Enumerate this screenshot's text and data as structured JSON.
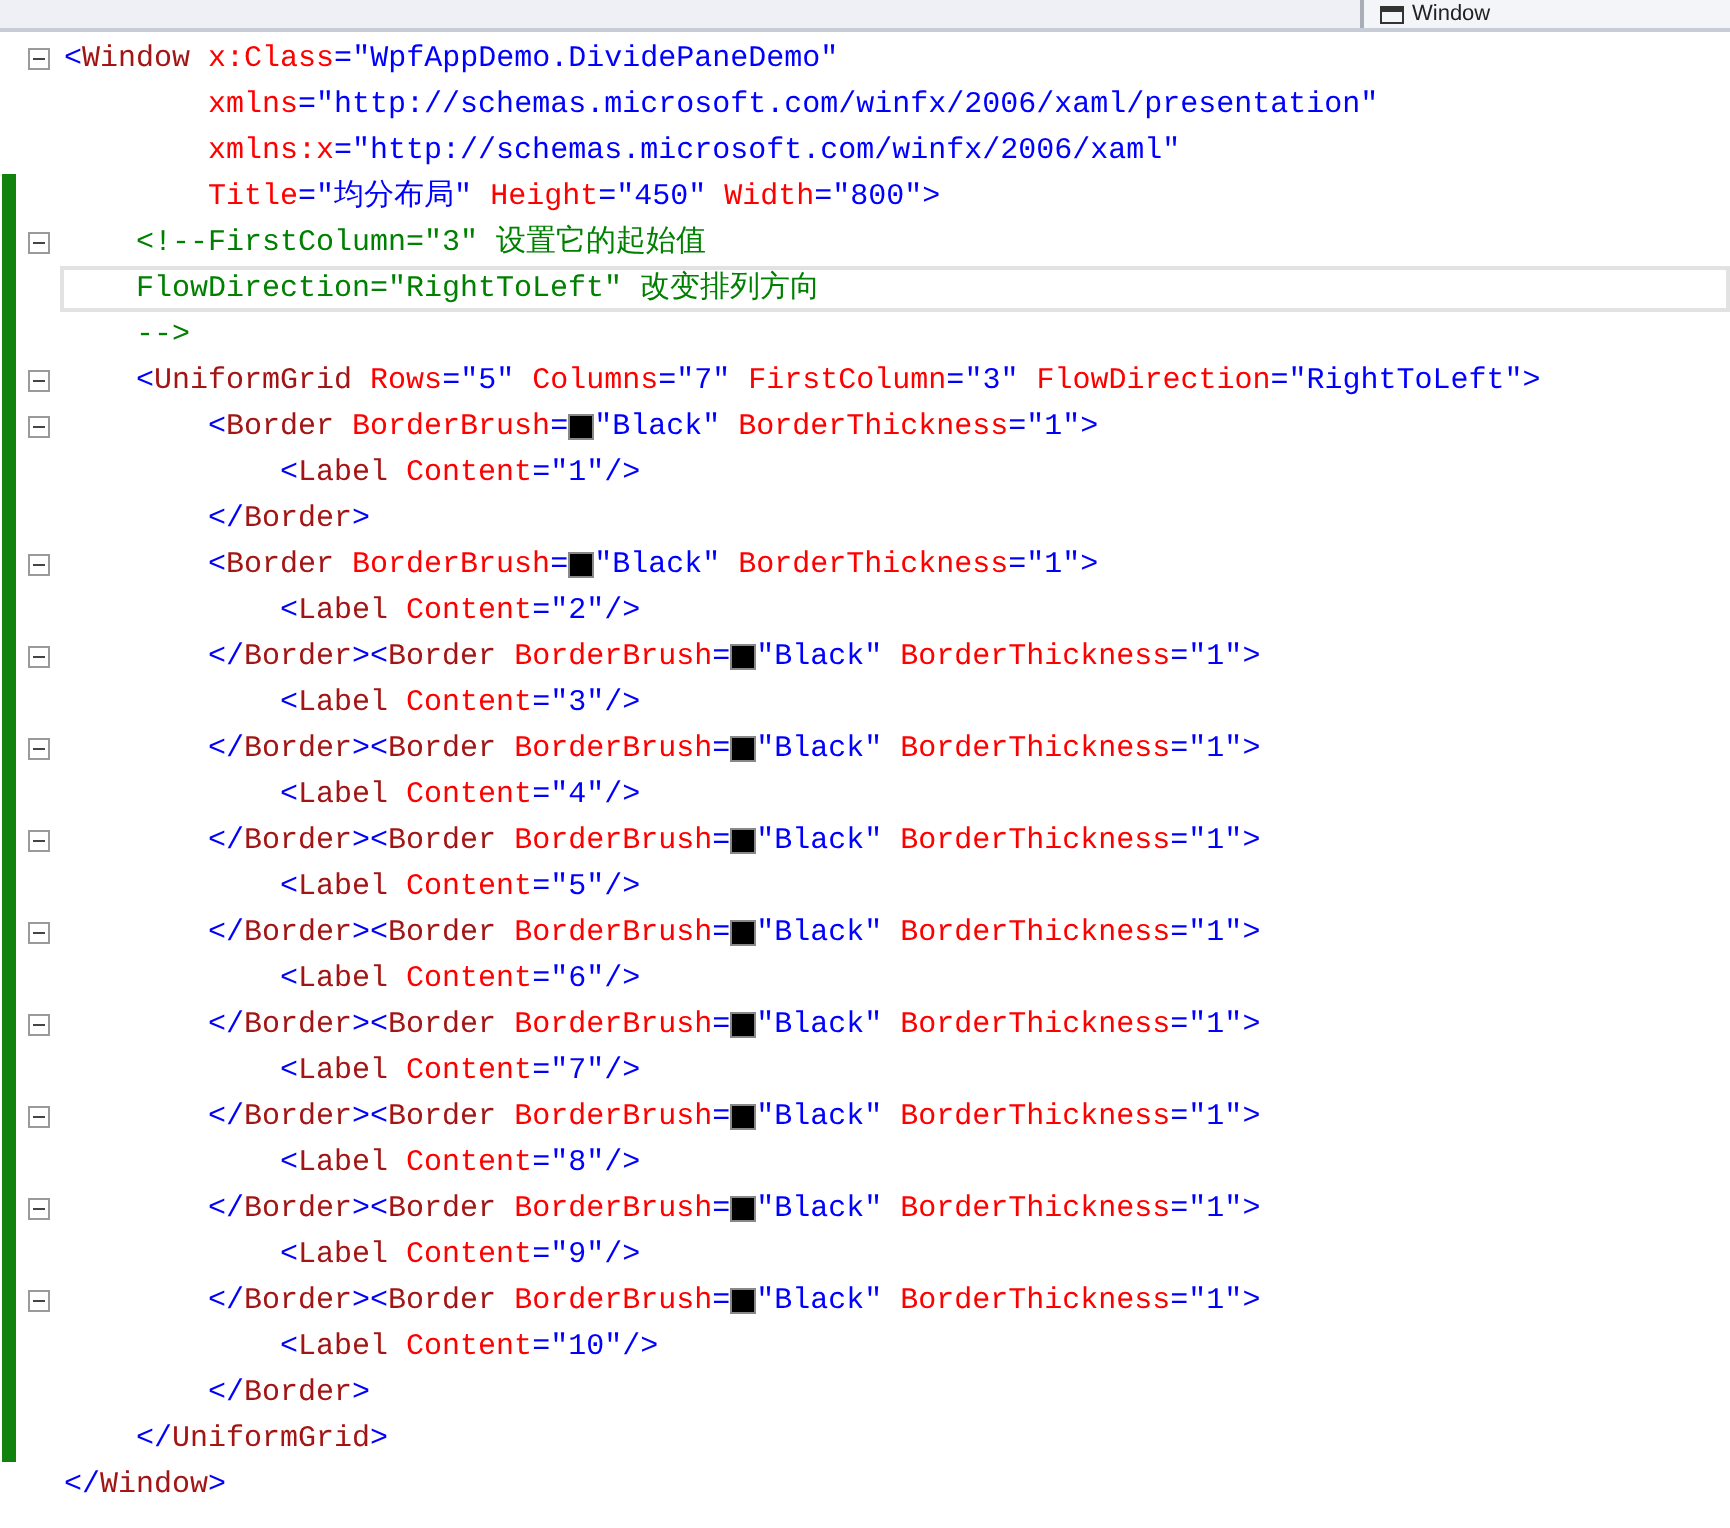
{
  "top_bar": {
    "dropdown": {
      "label": "Window"
    }
  },
  "lines": [
    {
      "fold": true,
      "changed": false,
      "current": false,
      "tokens": [
        {
          "kind": "punct",
          "text": "<"
        },
        {
          "kind": "element",
          "text": "Window"
        },
        {
          "kind": "attribute",
          "text": " x:Class"
        },
        {
          "kind": "punct",
          "text": "="
        },
        {
          "kind": "value",
          "text": "\"WpfAppDemo.DividePaneDemo\""
        }
      ]
    },
    {
      "fold": false,
      "changed": false,
      "current": false,
      "tokens": [
        {
          "kind": "attribute",
          "text": "        xmlns"
        },
        {
          "kind": "punct",
          "text": "="
        },
        {
          "kind": "value",
          "text": "\"http://schemas.microsoft.com/winfx/2006/xaml/presentation\""
        }
      ]
    },
    {
      "fold": false,
      "changed": false,
      "current": false,
      "tokens": [
        {
          "kind": "attribute",
          "text": "        xmlns:x"
        },
        {
          "kind": "punct",
          "text": "="
        },
        {
          "kind": "value",
          "text": "\"http://schemas.microsoft.com/winfx/2006/xaml\""
        }
      ]
    },
    {
      "fold": false,
      "changed": true,
      "current": false,
      "tokens": [
        {
          "kind": "attribute",
          "text": "        Title"
        },
        {
          "kind": "punct",
          "text": "="
        },
        {
          "kind": "value",
          "text": "\"均分布局\""
        },
        {
          "kind": "attribute",
          "text": " Height"
        },
        {
          "kind": "punct",
          "text": "="
        },
        {
          "kind": "value",
          "text": "\"450\""
        },
        {
          "kind": "attribute",
          "text": " Width"
        },
        {
          "kind": "punct",
          "text": "="
        },
        {
          "kind": "value",
          "text": "\"800\""
        },
        {
          "kind": "punct",
          "text": ">"
        }
      ]
    },
    {
      "fold": true,
      "changed": true,
      "current": false,
      "tokens": [
        {
          "kind": "comment",
          "text": "    <!--FirstColumn=\"3\" 设置它的起始值"
        }
      ]
    },
    {
      "fold": false,
      "changed": true,
      "current": true,
      "tokens": [
        {
          "kind": "comment",
          "text": "    FlowDirection=\"RightToLeft\" 改变排列方向"
        }
      ]
    },
    {
      "fold": false,
      "changed": true,
      "current": false,
      "tokens": [
        {
          "kind": "comment",
          "text": "    -->"
        }
      ]
    },
    {
      "fold": true,
      "changed": true,
      "current": false,
      "tokens": [
        {
          "kind": "punct",
          "text": "    <"
        },
        {
          "kind": "element",
          "text": "UniformGrid"
        },
        {
          "kind": "attribute",
          "text": " Rows"
        },
        {
          "kind": "punct",
          "text": "="
        },
        {
          "kind": "value",
          "text": "\"5\""
        },
        {
          "kind": "attribute",
          "text": " Columns"
        },
        {
          "kind": "punct",
          "text": "="
        },
        {
          "kind": "value",
          "text": "\"7\""
        },
        {
          "kind": "attribute",
          "text": " FirstColumn"
        },
        {
          "kind": "punct",
          "text": "="
        },
        {
          "kind": "value",
          "text": "\"3\""
        },
        {
          "kind": "attribute",
          "text": " FlowDirection"
        },
        {
          "kind": "punct",
          "text": "="
        },
        {
          "kind": "value",
          "text": "\"RightToLeft\""
        },
        {
          "kind": "punct",
          "text": ">"
        }
      ]
    },
    {
      "fold": true,
      "changed": true,
      "current": false,
      "tokens": [
        {
          "kind": "punct",
          "text": "        <"
        },
        {
          "kind": "element",
          "text": "Border"
        },
        {
          "kind": "attribute",
          "text": " BorderBrush"
        },
        {
          "kind": "punct",
          "text": "="
        },
        {
          "kind": "swatch",
          "color": "#000000"
        },
        {
          "kind": "value",
          "text": "\"Black\""
        },
        {
          "kind": "attribute",
          "text": " BorderThickness"
        },
        {
          "kind": "punct",
          "text": "="
        },
        {
          "kind": "value",
          "text": "\"1\""
        },
        {
          "kind": "punct",
          "text": ">"
        }
      ]
    },
    {
      "fold": false,
      "changed": true,
      "current": false,
      "tokens": [
        {
          "kind": "punct",
          "text": "            <"
        },
        {
          "kind": "element",
          "text": "Label"
        },
        {
          "kind": "attribute",
          "text": " Content"
        },
        {
          "kind": "punct",
          "text": "="
        },
        {
          "kind": "value",
          "text": "\"1\""
        },
        {
          "kind": "punct",
          "text": "/>"
        }
      ]
    },
    {
      "fold": false,
      "changed": true,
      "current": false,
      "tokens": [
        {
          "kind": "punct",
          "text": "        </"
        },
        {
          "kind": "element",
          "text": "Border"
        },
        {
          "kind": "punct",
          "text": ">"
        }
      ]
    },
    {
      "fold": true,
      "changed": true,
      "current": false,
      "tokens": [
        {
          "kind": "punct",
          "text": "        <"
        },
        {
          "kind": "element",
          "text": "Border"
        },
        {
          "kind": "attribute",
          "text": " BorderBrush"
        },
        {
          "kind": "punct",
          "text": "="
        },
        {
          "kind": "swatch",
          "color": "#000000"
        },
        {
          "kind": "value",
          "text": "\"Black\""
        },
        {
          "kind": "attribute",
          "text": " BorderThickness"
        },
        {
          "kind": "punct",
          "text": "="
        },
        {
          "kind": "value",
          "text": "\"1\""
        },
        {
          "kind": "punct",
          "text": ">"
        }
      ]
    },
    {
      "fold": false,
      "changed": true,
      "current": false,
      "tokens": [
        {
          "kind": "punct",
          "text": "            <"
        },
        {
          "kind": "element",
          "text": "Label"
        },
        {
          "kind": "attribute",
          "text": " Content"
        },
        {
          "kind": "punct",
          "text": "="
        },
        {
          "kind": "value",
          "text": "\"2\""
        },
        {
          "kind": "punct",
          "text": "/>"
        }
      ]
    },
    {
      "fold": true,
      "changed": true,
      "current": false,
      "tokens": [
        {
          "kind": "punct",
          "text": "        </"
        },
        {
          "kind": "element",
          "text": "Border"
        },
        {
          "kind": "punct",
          "text": "><"
        },
        {
          "kind": "element",
          "text": "Border"
        },
        {
          "kind": "attribute",
          "text": " BorderBrush"
        },
        {
          "kind": "punct",
          "text": "="
        },
        {
          "kind": "swatch",
          "color": "#000000"
        },
        {
          "kind": "value",
          "text": "\"Black\""
        },
        {
          "kind": "attribute",
          "text": " BorderThickness"
        },
        {
          "kind": "punct",
          "text": "="
        },
        {
          "kind": "value",
          "text": "\"1\""
        },
        {
          "kind": "punct",
          "text": ">"
        }
      ]
    },
    {
      "fold": false,
      "changed": true,
      "current": false,
      "tokens": [
        {
          "kind": "punct",
          "text": "            <"
        },
        {
          "kind": "element",
          "text": "Label"
        },
        {
          "kind": "attribute",
          "text": " Content"
        },
        {
          "kind": "punct",
          "text": "="
        },
        {
          "kind": "value",
          "text": "\"3\""
        },
        {
          "kind": "punct",
          "text": "/>"
        }
      ]
    },
    {
      "fold": true,
      "changed": true,
      "current": false,
      "tokens": [
        {
          "kind": "punct",
          "text": "        </"
        },
        {
          "kind": "element",
          "text": "Border"
        },
        {
          "kind": "punct",
          "text": "><"
        },
        {
          "kind": "element",
          "text": "Border"
        },
        {
          "kind": "attribute",
          "text": " BorderBrush"
        },
        {
          "kind": "punct",
          "text": "="
        },
        {
          "kind": "swatch",
          "color": "#000000"
        },
        {
          "kind": "value",
          "text": "\"Black\""
        },
        {
          "kind": "attribute",
          "text": " BorderThickness"
        },
        {
          "kind": "punct",
          "text": "="
        },
        {
          "kind": "value",
          "text": "\"1\""
        },
        {
          "kind": "punct",
          "text": ">"
        }
      ]
    },
    {
      "fold": false,
      "changed": true,
      "current": false,
      "tokens": [
        {
          "kind": "punct",
          "text": "            <"
        },
        {
          "kind": "element",
          "text": "Label"
        },
        {
          "kind": "attribute",
          "text": " Content"
        },
        {
          "kind": "punct",
          "text": "="
        },
        {
          "kind": "value",
          "text": "\"4\""
        },
        {
          "kind": "punct",
          "text": "/>"
        }
      ]
    },
    {
      "fold": true,
      "changed": true,
      "current": false,
      "tokens": [
        {
          "kind": "punct",
          "text": "        </"
        },
        {
          "kind": "element",
          "text": "Border"
        },
        {
          "kind": "punct",
          "text": "><"
        },
        {
          "kind": "element",
          "text": "Border"
        },
        {
          "kind": "attribute",
          "text": " BorderBrush"
        },
        {
          "kind": "punct",
          "text": "="
        },
        {
          "kind": "swatch",
          "color": "#000000"
        },
        {
          "kind": "value",
          "text": "\"Black\""
        },
        {
          "kind": "attribute",
          "text": " BorderThickness"
        },
        {
          "kind": "punct",
          "text": "="
        },
        {
          "kind": "value",
          "text": "\"1\""
        },
        {
          "kind": "punct",
          "text": ">"
        }
      ]
    },
    {
      "fold": false,
      "changed": true,
      "current": false,
      "tokens": [
        {
          "kind": "punct",
          "text": "            <"
        },
        {
          "kind": "element",
          "text": "Label"
        },
        {
          "kind": "attribute",
          "text": " Content"
        },
        {
          "kind": "punct",
          "text": "="
        },
        {
          "kind": "value",
          "text": "\"5\""
        },
        {
          "kind": "punct",
          "text": "/>"
        }
      ]
    },
    {
      "fold": true,
      "changed": true,
      "current": false,
      "tokens": [
        {
          "kind": "punct",
          "text": "        </"
        },
        {
          "kind": "element",
          "text": "Border"
        },
        {
          "kind": "punct",
          "text": "><"
        },
        {
          "kind": "element",
          "text": "Border"
        },
        {
          "kind": "attribute",
          "text": " BorderBrush"
        },
        {
          "kind": "punct",
          "text": "="
        },
        {
          "kind": "swatch",
          "color": "#000000"
        },
        {
          "kind": "value",
          "text": "\"Black\""
        },
        {
          "kind": "attribute",
          "text": " BorderThickness"
        },
        {
          "kind": "punct",
          "text": "="
        },
        {
          "kind": "value",
          "text": "\"1\""
        },
        {
          "kind": "punct",
          "text": ">"
        }
      ]
    },
    {
      "fold": false,
      "changed": true,
      "current": false,
      "tokens": [
        {
          "kind": "punct",
          "text": "            <"
        },
        {
          "kind": "element",
          "text": "Label"
        },
        {
          "kind": "attribute",
          "text": " Content"
        },
        {
          "kind": "punct",
          "text": "="
        },
        {
          "kind": "value",
          "text": "\"6\""
        },
        {
          "kind": "punct",
          "text": "/>"
        }
      ]
    },
    {
      "fold": true,
      "changed": true,
      "current": false,
      "tokens": [
        {
          "kind": "punct",
          "text": "        </"
        },
        {
          "kind": "element",
          "text": "Border"
        },
        {
          "kind": "punct",
          "text": "><"
        },
        {
          "kind": "element",
          "text": "Border"
        },
        {
          "kind": "attribute",
          "text": " BorderBrush"
        },
        {
          "kind": "punct",
          "text": "="
        },
        {
          "kind": "swatch",
          "color": "#000000"
        },
        {
          "kind": "value",
          "text": "\"Black\""
        },
        {
          "kind": "attribute",
          "text": " BorderThickness"
        },
        {
          "kind": "punct",
          "text": "="
        },
        {
          "kind": "value",
          "text": "\"1\""
        },
        {
          "kind": "punct",
          "text": ">"
        }
      ]
    },
    {
      "fold": false,
      "changed": true,
      "current": false,
      "tokens": [
        {
          "kind": "punct",
          "text": "            <"
        },
        {
          "kind": "element",
          "text": "Label"
        },
        {
          "kind": "attribute",
          "text": " Content"
        },
        {
          "kind": "punct",
          "text": "="
        },
        {
          "kind": "value",
          "text": "\"7\""
        },
        {
          "kind": "punct",
          "text": "/>"
        }
      ]
    },
    {
      "fold": true,
      "changed": true,
      "current": false,
      "tokens": [
        {
          "kind": "punct",
          "text": "        </"
        },
        {
          "kind": "element",
          "text": "Border"
        },
        {
          "kind": "punct",
          "text": "><"
        },
        {
          "kind": "element",
          "text": "Border"
        },
        {
          "kind": "attribute",
          "text": " BorderBrush"
        },
        {
          "kind": "punct",
          "text": "="
        },
        {
          "kind": "swatch",
          "color": "#000000"
        },
        {
          "kind": "value",
          "text": "\"Black\""
        },
        {
          "kind": "attribute",
          "text": " BorderThickness"
        },
        {
          "kind": "punct",
          "text": "="
        },
        {
          "kind": "value",
          "text": "\"1\""
        },
        {
          "kind": "punct",
          "text": ">"
        }
      ]
    },
    {
      "fold": false,
      "changed": true,
      "current": false,
      "tokens": [
        {
          "kind": "punct",
          "text": "            <"
        },
        {
          "kind": "element",
          "text": "Label"
        },
        {
          "kind": "attribute",
          "text": " Content"
        },
        {
          "kind": "punct",
          "text": "="
        },
        {
          "kind": "value",
          "text": "\"8\""
        },
        {
          "kind": "punct",
          "text": "/>"
        }
      ]
    },
    {
      "fold": true,
      "changed": true,
      "current": false,
      "tokens": [
        {
          "kind": "punct",
          "text": "        </"
        },
        {
          "kind": "element",
          "text": "Border"
        },
        {
          "kind": "punct",
          "text": "><"
        },
        {
          "kind": "element",
          "text": "Border"
        },
        {
          "kind": "attribute",
          "text": " BorderBrush"
        },
        {
          "kind": "punct",
          "text": "="
        },
        {
          "kind": "swatch",
          "color": "#000000"
        },
        {
          "kind": "value",
          "text": "\"Black\""
        },
        {
          "kind": "attribute",
          "text": " BorderThickness"
        },
        {
          "kind": "punct",
          "text": "="
        },
        {
          "kind": "value",
          "text": "\"1\""
        },
        {
          "kind": "punct",
          "text": ">"
        }
      ]
    },
    {
      "fold": false,
      "changed": true,
      "current": false,
      "tokens": [
        {
          "kind": "punct",
          "text": "            <"
        },
        {
          "kind": "element",
          "text": "Label"
        },
        {
          "kind": "attribute",
          "text": " Content"
        },
        {
          "kind": "punct",
          "text": "="
        },
        {
          "kind": "value",
          "text": "\"9\""
        },
        {
          "kind": "punct",
          "text": "/>"
        }
      ]
    },
    {
      "fold": true,
      "changed": true,
      "current": false,
      "tokens": [
        {
          "kind": "punct",
          "text": "        </"
        },
        {
          "kind": "element",
          "text": "Border"
        },
        {
          "kind": "punct",
          "text": "><"
        },
        {
          "kind": "element",
          "text": "Border"
        },
        {
          "kind": "attribute",
          "text": " BorderBrush"
        },
        {
          "kind": "punct",
          "text": "="
        },
        {
          "kind": "swatch",
          "color": "#000000"
        },
        {
          "kind": "value",
          "text": "\"Black\""
        },
        {
          "kind": "attribute",
          "text": " BorderThickness"
        },
        {
          "kind": "punct",
          "text": "="
        },
        {
          "kind": "value",
          "text": "\"1\""
        },
        {
          "kind": "punct",
          "text": ">"
        }
      ]
    },
    {
      "fold": false,
      "changed": true,
      "current": false,
      "tokens": [
        {
          "kind": "punct",
          "text": "            <"
        },
        {
          "kind": "element",
          "text": "Label"
        },
        {
          "kind": "attribute",
          "text": " Content"
        },
        {
          "kind": "punct",
          "text": "="
        },
        {
          "kind": "value",
          "text": "\"10\""
        },
        {
          "kind": "punct",
          "text": "/>"
        }
      ]
    },
    {
      "fold": false,
      "changed": true,
      "current": false,
      "tokens": [
        {
          "kind": "punct",
          "text": "        </"
        },
        {
          "kind": "element",
          "text": "Border"
        },
        {
          "kind": "punct",
          "text": ">"
        }
      ]
    },
    {
      "fold": false,
      "changed": true,
      "current": false,
      "tokens": [
        {
          "kind": "punct",
          "text": "    </"
        },
        {
          "kind": "element",
          "text": "UniformGrid"
        },
        {
          "kind": "punct",
          "text": ">"
        }
      ]
    },
    {
      "fold": false,
      "changed": false,
      "current": false,
      "tokens": [
        {
          "kind": "punct",
          "text": "</"
        },
        {
          "kind": "element",
          "text": "Window"
        },
        {
          "kind": "punct",
          "text": ">"
        }
      ]
    }
  ]
}
